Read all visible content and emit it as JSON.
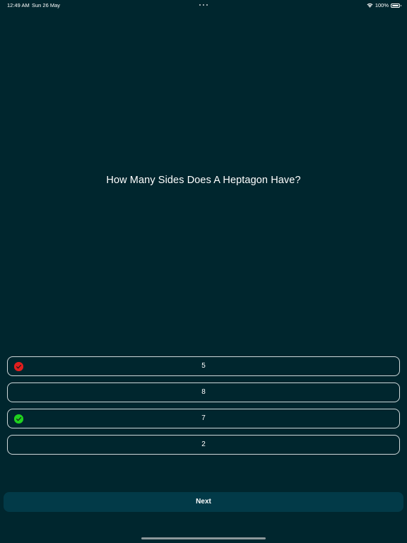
{
  "status_bar": {
    "time": "12:49 AM",
    "date": "Sun 26 May",
    "battery_percent": "100%",
    "battery_level": 1.0
  },
  "question": {
    "text": "How Many Sides Does A Heptagon Have?"
  },
  "answers": [
    {
      "label": "5",
      "state": "incorrect",
      "icon": "x-circle-icon"
    },
    {
      "label": "8",
      "state": "neutral"
    },
    {
      "label": "7",
      "state": "correct",
      "icon": "check-circle-icon"
    },
    {
      "label": "2",
      "state": "neutral"
    }
  ],
  "next_button": {
    "label": "Next"
  },
  "colors": {
    "background": "#00262e",
    "incorrect": "#e01e1e",
    "correct": "#1fd11f",
    "button": "#023a48"
  }
}
